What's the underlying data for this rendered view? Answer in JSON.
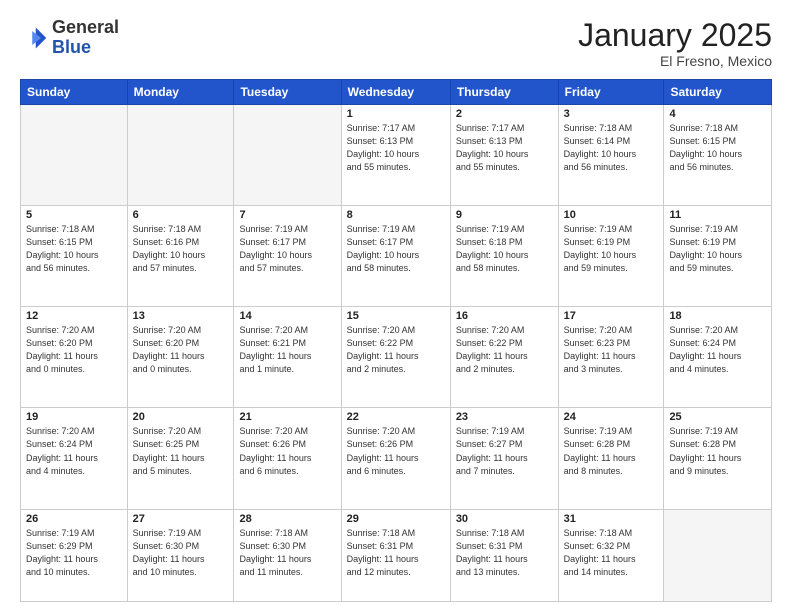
{
  "header": {
    "logo_general": "General",
    "logo_blue": "Blue",
    "month_title": "January 2025",
    "subtitle": "El Fresno, Mexico"
  },
  "days_of_week": [
    "Sunday",
    "Monday",
    "Tuesday",
    "Wednesday",
    "Thursday",
    "Friday",
    "Saturday"
  ],
  "weeks": [
    [
      {
        "day": "",
        "info": ""
      },
      {
        "day": "",
        "info": ""
      },
      {
        "day": "",
        "info": ""
      },
      {
        "day": "1",
        "info": "Sunrise: 7:17 AM\nSunset: 6:13 PM\nDaylight: 10 hours\nand 55 minutes."
      },
      {
        "day": "2",
        "info": "Sunrise: 7:17 AM\nSunset: 6:13 PM\nDaylight: 10 hours\nand 55 minutes."
      },
      {
        "day": "3",
        "info": "Sunrise: 7:18 AM\nSunset: 6:14 PM\nDaylight: 10 hours\nand 56 minutes."
      },
      {
        "day": "4",
        "info": "Sunrise: 7:18 AM\nSunset: 6:15 PM\nDaylight: 10 hours\nand 56 minutes."
      }
    ],
    [
      {
        "day": "5",
        "info": "Sunrise: 7:18 AM\nSunset: 6:15 PM\nDaylight: 10 hours\nand 56 minutes."
      },
      {
        "day": "6",
        "info": "Sunrise: 7:18 AM\nSunset: 6:16 PM\nDaylight: 10 hours\nand 57 minutes."
      },
      {
        "day": "7",
        "info": "Sunrise: 7:19 AM\nSunset: 6:17 PM\nDaylight: 10 hours\nand 57 minutes."
      },
      {
        "day": "8",
        "info": "Sunrise: 7:19 AM\nSunset: 6:17 PM\nDaylight: 10 hours\nand 58 minutes."
      },
      {
        "day": "9",
        "info": "Sunrise: 7:19 AM\nSunset: 6:18 PM\nDaylight: 10 hours\nand 58 minutes."
      },
      {
        "day": "10",
        "info": "Sunrise: 7:19 AM\nSunset: 6:19 PM\nDaylight: 10 hours\nand 59 minutes."
      },
      {
        "day": "11",
        "info": "Sunrise: 7:19 AM\nSunset: 6:19 PM\nDaylight: 10 hours\nand 59 minutes."
      }
    ],
    [
      {
        "day": "12",
        "info": "Sunrise: 7:20 AM\nSunset: 6:20 PM\nDaylight: 11 hours\nand 0 minutes."
      },
      {
        "day": "13",
        "info": "Sunrise: 7:20 AM\nSunset: 6:20 PM\nDaylight: 11 hours\nand 0 minutes."
      },
      {
        "day": "14",
        "info": "Sunrise: 7:20 AM\nSunset: 6:21 PM\nDaylight: 11 hours\nand 1 minute."
      },
      {
        "day": "15",
        "info": "Sunrise: 7:20 AM\nSunset: 6:22 PM\nDaylight: 11 hours\nand 2 minutes."
      },
      {
        "day": "16",
        "info": "Sunrise: 7:20 AM\nSunset: 6:22 PM\nDaylight: 11 hours\nand 2 minutes."
      },
      {
        "day": "17",
        "info": "Sunrise: 7:20 AM\nSunset: 6:23 PM\nDaylight: 11 hours\nand 3 minutes."
      },
      {
        "day": "18",
        "info": "Sunrise: 7:20 AM\nSunset: 6:24 PM\nDaylight: 11 hours\nand 4 minutes."
      }
    ],
    [
      {
        "day": "19",
        "info": "Sunrise: 7:20 AM\nSunset: 6:24 PM\nDaylight: 11 hours\nand 4 minutes."
      },
      {
        "day": "20",
        "info": "Sunrise: 7:20 AM\nSunset: 6:25 PM\nDaylight: 11 hours\nand 5 minutes."
      },
      {
        "day": "21",
        "info": "Sunrise: 7:20 AM\nSunset: 6:26 PM\nDaylight: 11 hours\nand 6 minutes."
      },
      {
        "day": "22",
        "info": "Sunrise: 7:20 AM\nSunset: 6:26 PM\nDaylight: 11 hours\nand 6 minutes."
      },
      {
        "day": "23",
        "info": "Sunrise: 7:19 AM\nSunset: 6:27 PM\nDaylight: 11 hours\nand 7 minutes."
      },
      {
        "day": "24",
        "info": "Sunrise: 7:19 AM\nSunset: 6:28 PM\nDaylight: 11 hours\nand 8 minutes."
      },
      {
        "day": "25",
        "info": "Sunrise: 7:19 AM\nSunset: 6:28 PM\nDaylight: 11 hours\nand 9 minutes."
      }
    ],
    [
      {
        "day": "26",
        "info": "Sunrise: 7:19 AM\nSunset: 6:29 PM\nDaylight: 11 hours\nand 10 minutes."
      },
      {
        "day": "27",
        "info": "Sunrise: 7:19 AM\nSunset: 6:30 PM\nDaylight: 11 hours\nand 10 minutes."
      },
      {
        "day": "28",
        "info": "Sunrise: 7:18 AM\nSunset: 6:30 PM\nDaylight: 11 hours\nand 11 minutes."
      },
      {
        "day": "29",
        "info": "Sunrise: 7:18 AM\nSunset: 6:31 PM\nDaylight: 11 hours\nand 12 minutes."
      },
      {
        "day": "30",
        "info": "Sunrise: 7:18 AM\nSunset: 6:31 PM\nDaylight: 11 hours\nand 13 minutes."
      },
      {
        "day": "31",
        "info": "Sunrise: 7:18 AM\nSunset: 6:32 PM\nDaylight: 11 hours\nand 14 minutes."
      },
      {
        "day": "",
        "info": ""
      }
    ]
  ]
}
